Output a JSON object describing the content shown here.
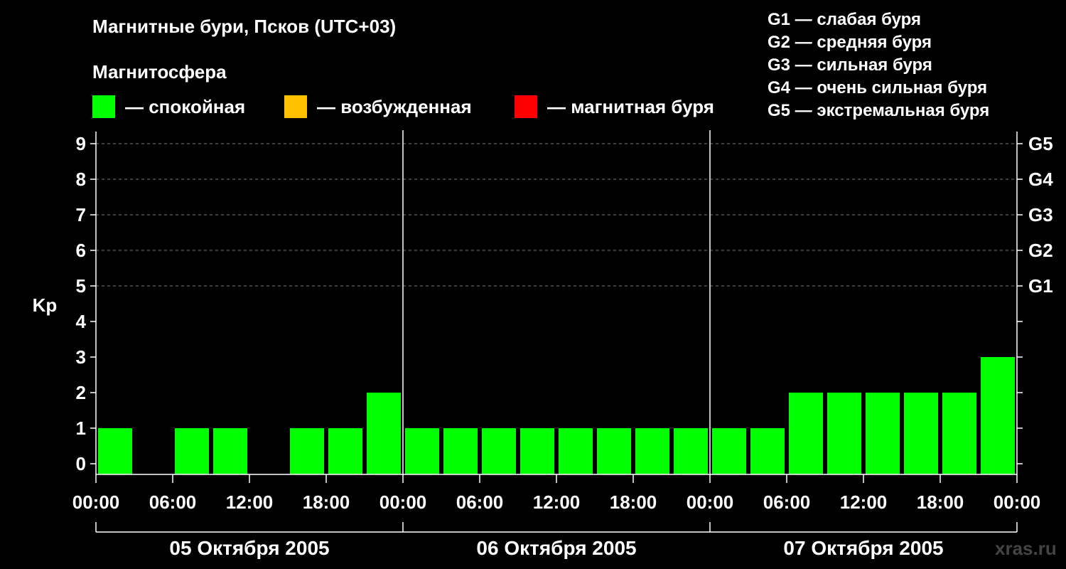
{
  "title": "Магнитные бури, Псков (UTC+03)",
  "subtitle": "Магнитосфера",
  "legend": [
    {
      "label": "— спокойная",
      "color": "#00ff00"
    },
    {
      "label": "— возбужденная",
      "color": "#ffc000"
    },
    {
      "label": "— магнитная буря",
      "color": "#ff0000"
    }
  ],
  "g_scale": [
    "G1 — слабая буря",
    "G2 — средняя буря",
    "G3 — сильная буря",
    "G4 — очень сильная буря",
    "G5 — экстремальная буря"
  ],
  "watermark": "xras.ru",
  "chart_data": {
    "type": "bar",
    "ylabel": "Kp",
    "ylim": [
      0,
      9
    ],
    "yticks": [
      0,
      1,
      2,
      3,
      4,
      5,
      6,
      7,
      8,
      9
    ],
    "right_ticks": [
      {
        "value": 5,
        "label": "G1"
      },
      {
        "value": 6,
        "label": "G2"
      },
      {
        "value": 7,
        "label": "G3"
      },
      {
        "value": 8,
        "label": "G4"
      },
      {
        "value": 9,
        "label": "G5"
      }
    ],
    "grid": "horizontal dashed at 5–9",
    "xtick_labels": [
      "00:00",
      "06:00",
      "12:00",
      "18:00",
      "00:00",
      "06:00",
      "12:00",
      "18:00",
      "00:00",
      "06:00",
      "12:00",
      "18:00",
      "00:00"
    ],
    "days": [
      "05 Октября 2005",
      "06 Октября 2005",
      "07 Октября 2005"
    ],
    "interval_hours": 3,
    "values": [
      1,
      0,
      1,
      1,
      0,
      1,
      1,
      2,
      1,
      1,
      1,
      1,
      1,
      1,
      1,
      1,
      1,
      1,
      2,
      2,
      2,
      2,
      2,
      3
    ],
    "bar_color": "#00ff00"
  }
}
